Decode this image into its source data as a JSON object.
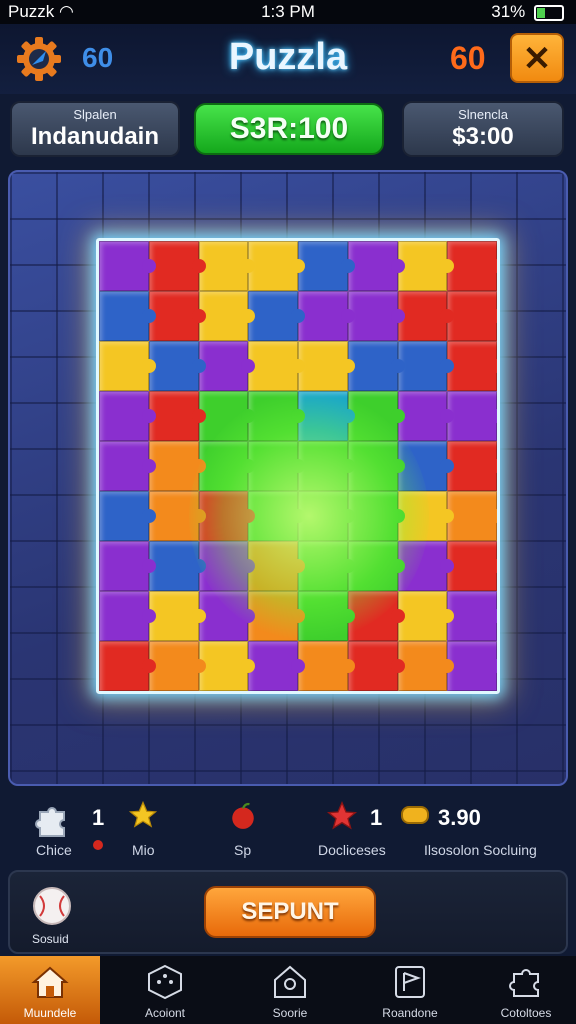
{
  "status_bar": {
    "carrier": "Puzzk",
    "time": "1:3 PM",
    "battery": "31%",
    "battery_level": 0.31
  },
  "header": {
    "title": "Puzzla",
    "score_left": "60",
    "score_right": "60",
    "settings_icon": "gear-icon",
    "close_icon": "close-icon",
    "close_label": "✕"
  },
  "info": {
    "left": {
      "small": "Slpalen",
      "big": "Indanudain"
    },
    "middle": "S3R:100",
    "right": {
      "small": "Slnencla",
      "big": "$3:00"
    }
  },
  "board": {
    "columns": 8,
    "rows": 9,
    "colors": {
      "purple": "#8a2fcf",
      "blue": "#2e63c8",
      "red": "#e12a22",
      "yellow": "#f4c623",
      "orange": "#f38a1c",
      "green": "#3ecf2c",
      "teal": "#1aa7c9"
    },
    "layout": [
      [
        "purple",
        "red",
        "yellow",
        "yellow",
        "blue",
        "purple",
        "yellow",
        "red"
      ],
      [
        "blue",
        "red",
        "yellow",
        "blue",
        "purple",
        "purple",
        "red",
        "red"
      ],
      [
        "yellow",
        "blue",
        "purple",
        "yellow",
        "yellow",
        "blue",
        "blue",
        "red"
      ],
      [
        "purple",
        "red",
        "green",
        "green",
        "teal",
        "green",
        "purple",
        "purple"
      ],
      [
        "purple",
        "orange",
        "green",
        "green",
        "green",
        "green",
        "blue",
        "red"
      ],
      [
        "blue",
        "orange",
        "red",
        "green",
        "green",
        "green",
        "yellow",
        "orange"
      ],
      [
        "purple",
        "blue",
        "purple",
        "orange",
        "green",
        "green",
        "purple",
        "red"
      ],
      [
        "purple",
        "yellow",
        "purple",
        "orange",
        "green",
        "red",
        "yellow",
        "purple"
      ],
      [
        "red",
        "orange",
        "yellow",
        "purple",
        "orange",
        "red",
        "orange",
        "purple"
      ]
    ]
  },
  "stats": [
    {
      "icon": "puzzle-piece-icon",
      "value": "1",
      "label": "Chice"
    },
    {
      "icon": "star-icon",
      "value": "",
      "label": "Mio"
    },
    {
      "icon": "apple-icon",
      "value": "",
      "label": "Sp"
    },
    {
      "icon": "star-red-icon",
      "value": "1",
      "label": "Docliceses"
    },
    {
      "icon": "coin-icon",
      "value": "3.90",
      "label": "Ilsosolon Socluing"
    }
  ],
  "action": {
    "ball_label": "Sosuid",
    "primary_button": "SEPUNT"
  },
  "nav": [
    {
      "icon": "home-icon",
      "label": "Muundele",
      "active": true
    },
    {
      "icon": "dice-icon",
      "label": "Acoiont",
      "active": false
    },
    {
      "icon": "house-icon",
      "label": "Soorie",
      "active": false
    },
    {
      "icon": "flag-icon",
      "label": "Roandone",
      "active": false
    },
    {
      "icon": "puzzle-icon",
      "label": "Cotoltoes",
      "active": false
    }
  ]
}
